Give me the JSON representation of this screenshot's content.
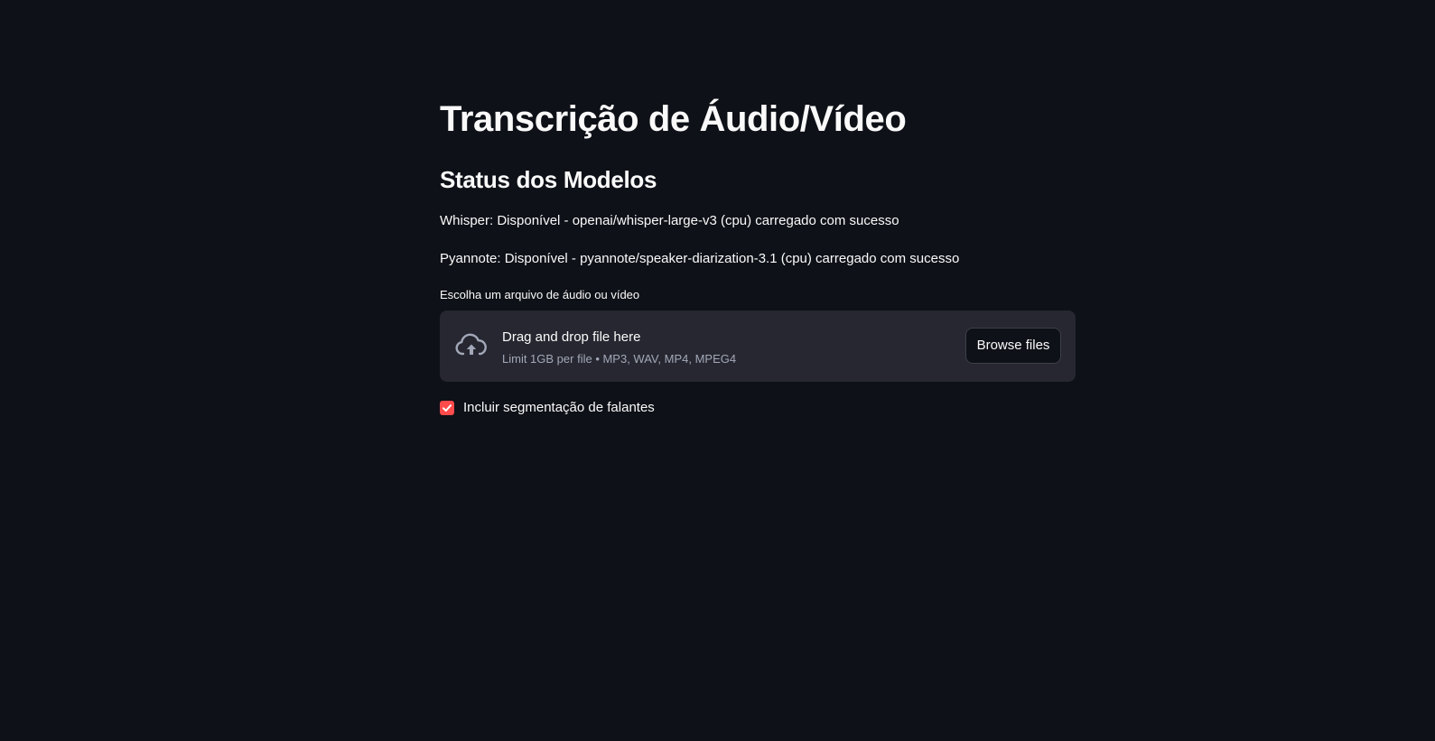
{
  "page": {
    "title": "Transcrição de Áudio/Vídeo",
    "section_title": "Status dos Modelos"
  },
  "status": {
    "whisper": "Whisper: Disponível - openai/whisper-large-v3 (cpu) carregado com sucesso",
    "pyannote": "Pyannote: Disponível - pyannote/speaker-diarization-3.1 (cpu) carregado com sucesso"
  },
  "uploader": {
    "label": "Escolha um arquivo de áudio ou vídeo",
    "drop_title": "Drag and drop file here",
    "limit_text": "Limit 1GB per file • MP3, WAV, MP4, MPEG4",
    "browse_label": "Browse files",
    "icon": "cloud-upload-icon"
  },
  "options": {
    "speaker_segmentation_label": "Incluir segmentação de falantes",
    "speaker_segmentation_checked": true
  },
  "colors": {
    "background": "#0e1117",
    "dropzone": "#262730",
    "accent": "#ff4b4b",
    "text": "#fafafa",
    "muted_text": "#a3a8b8"
  }
}
